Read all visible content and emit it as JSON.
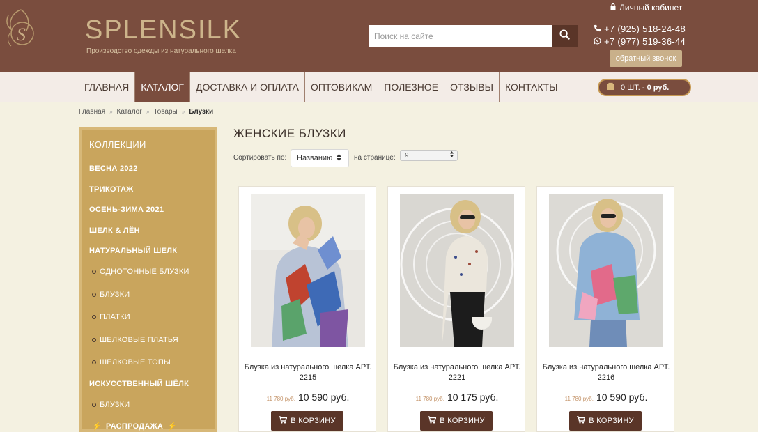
{
  "header": {
    "brand": "SPLENSILK",
    "tagline": "Производство одежды из натурального шелка",
    "search_placeholder": "Поиск на сайте",
    "cabinet_label": "Личный кабинет",
    "phone1": "+7 (925) 518-24-48",
    "phone2": "+7 (977) 519-36-44",
    "callback_label": "обратный звонок"
  },
  "nav": {
    "items": [
      "ГЛАВНАЯ",
      "КАТАЛОГ",
      "ДОСТАВКА И ОПЛАТА",
      "ОПТОВИКАМ",
      "ПОЛЕЗНОЕ",
      "ОТЗЫВЫ",
      "КОНТАКТЫ"
    ],
    "active_index": 1
  },
  "cart": {
    "count": "0 ШТ.",
    "sep": "-",
    "total": "0 руб."
  },
  "breadcrumb": {
    "items": [
      "Главная",
      "Каталог",
      "Товары"
    ],
    "current": "Блузки",
    "separator": "»"
  },
  "sidebar": {
    "title": "КОЛЛЕКЦИИ",
    "items": [
      {
        "label": "ВЕСНА 2022",
        "type": "main"
      },
      {
        "label": "ТРИКОТАЖ",
        "type": "main"
      },
      {
        "label": "ОСЕНЬ-ЗИМА 2021",
        "type": "main"
      },
      {
        "label": "ШЕЛК & ЛЁН",
        "type": "main"
      },
      {
        "label": "НАТУРАЛЬНЫЙ ШЕЛК",
        "type": "main"
      },
      {
        "label": "ОДНОТОННЫЕ БЛУЗКИ",
        "type": "sub"
      },
      {
        "label": "БЛУЗКИ",
        "type": "sub"
      },
      {
        "label": "ПЛАТКИ",
        "type": "sub"
      },
      {
        "label": "ШЕЛКОВЫЕ ПЛАТЬЯ",
        "type": "sub"
      },
      {
        "label": "ШЕЛКОВЫЕ ТОПЫ",
        "type": "sub"
      },
      {
        "label": "ИСКУССТВЕННЫЙ ШЁЛК",
        "type": "main"
      },
      {
        "label": "БЛУЗКИ",
        "type": "sub"
      },
      {
        "label": "РАСПРОДАЖА",
        "type": "sale"
      }
    ]
  },
  "main": {
    "title": "ЖЕНСКИЕ БЛУЗКИ",
    "sort_label": "Сортировать по:",
    "sort_value": "Названию",
    "perpage_label": "на странице:",
    "perpage_value": "9"
  },
  "products": [
    {
      "name": "Блузка из натурального шелка АРТ. 2215",
      "old_price": "11 780 руб.",
      "price": "10 590 руб.",
      "button": "В КОРЗИНУ"
    },
    {
      "name": "Блузка из натурального шелка АРТ. 2221",
      "old_price": "11 780 руб.",
      "price": "10 175 руб.",
      "button": "В КОРЗИНУ"
    },
    {
      "name": "Блузка из натурального шелка АРТ. 2216",
      "old_price": "11 780 руб.",
      "price": "10 590 руб.",
      "button": "В КОРЗИНУ"
    }
  ],
  "colors": {
    "header_bg": "#7a4d3e",
    "sidebar_bg": "#c9a55d",
    "page_bg": "#f4f1e1",
    "button_bg": "#5a3528"
  }
}
